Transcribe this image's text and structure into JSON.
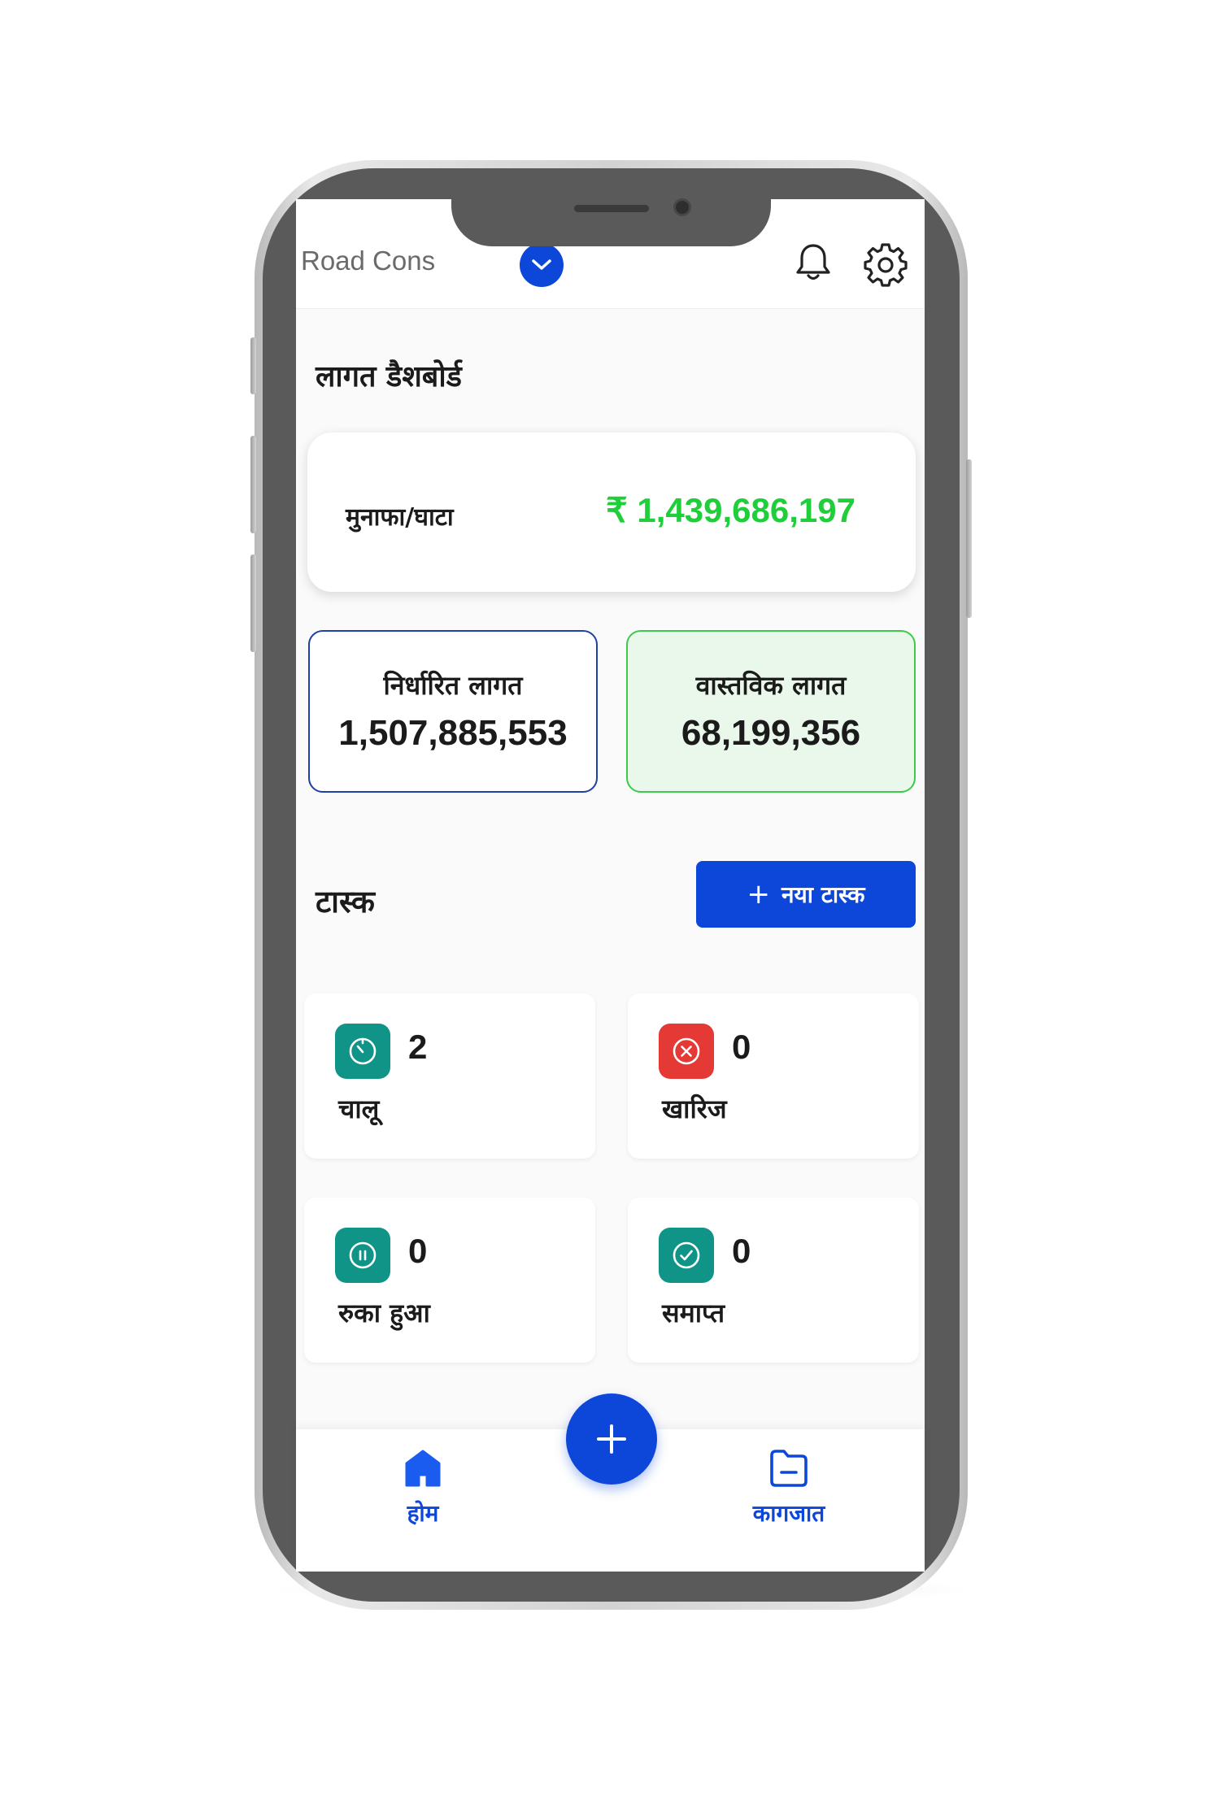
{
  "header": {
    "project_name": "Road Cons",
    "dropdown_icon": "chevron-down-icon",
    "notification_icon": "bell-icon",
    "settings_icon": "gear-icon"
  },
  "dashboard": {
    "title": "लागत डैशबोर्ड",
    "profit_loss": {
      "label": "मुनाफा/घाटा",
      "value": "₹  1,439,686,197",
      "color": "#1fcf3a"
    },
    "planned_cost": {
      "label": "निर्धारित लागत",
      "value": "1,507,885,553",
      "border_color": "#1e40a8"
    },
    "actual_cost": {
      "label": "वास्तविक लागत",
      "value": "68,199,356",
      "border_color": "#3cc94c"
    }
  },
  "tasks": {
    "title": "टास्क",
    "new_task_label": "नया टास्क",
    "cards": [
      {
        "label": "चालू",
        "count": "2",
        "icon": "timer-icon",
        "color": "#119488"
      },
      {
        "label": "खारिज",
        "count": "0",
        "icon": "cancel-circle-icon",
        "color": "#e53935"
      },
      {
        "label": "रुका हुआ",
        "count": "0",
        "icon": "pause-circle-icon",
        "color": "#119488"
      },
      {
        "label": "समाप्त",
        "count": "0",
        "icon": "check-circle-icon",
        "color": "#119488"
      }
    ]
  },
  "bottom_nav": {
    "home_label": "होम",
    "docs_label": "कागजात",
    "fab_icon": "plus-icon",
    "active_color": "#0d47d9"
  }
}
